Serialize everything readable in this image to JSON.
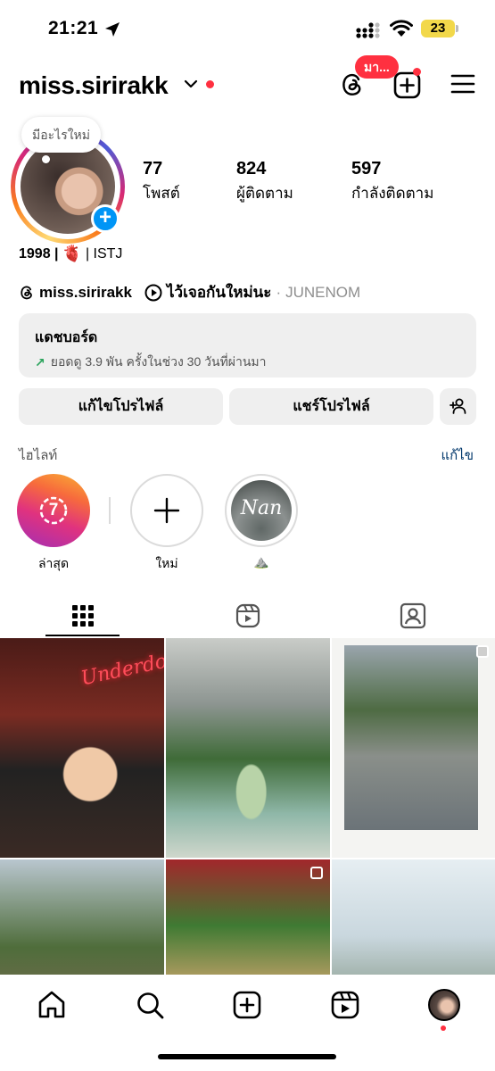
{
  "status_bar": {
    "time": "21:21",
    "battery": "23"
  },
  "header": {
    "username": "miss.sirirakk",
    "threads_badge": "มา..."
  },
  "profile": {
    "note": "มีอะไรใหม่",
    "stats": [
      {
        "value": "77",
        "label": "โพสต์"
      },
      {
        "value": "824",
        "label": "ผู้ติดตาม"
      },
      {
        "value": "597",
        "label": "กำลังติดตาม"
      }
    ],
    "bio": {
      "year": "1998 |",
      "heart": "🫀",
      "mbti": "| ISTJ"
    },
    "threads_handle": "miss.sirirakk",
    "music_title": "ไว้เจอกันใหม่นะ",
    "music_sep": "·",
    "music_artist": "JUNENOM"
  },
  "dashboard": {
    "title": "แดชบอร์ด",
    "arrow": "↗",
    "subtitle": "ยอดดู 3.9 พัน ครั้งในช่วง 30 วันที่ผ่านมา"
  },
  "buttons": {
    "edit_profile": "แก้ไขโปรไฟล์",
    "share_profile": "แชร์โปรไฟล์"
  },
  "highlights": {
    "title": "ไฮไลท์",
    "edit": "แก้ไข",
    "items": [
      {
        "label": "ล่าสุด",
        "badge": "7"
      },
      {
        "label": "ใหม่"
      },
      {
        "label": "⛰️",
        "cover_text": "Nan"
      }
    ]
  },
  "grid": {
    "posts": [
      {
        "overlay": "Underdog",
        "multi": false
      },
      {
        "overlay": "",
        "multi": false
      },
      {
        "overlay": "",
        "multi": true
      },
      {
        "overlay": "",
        "multi": false
      },
      {
        "overlay": "",
        "multi": true
      },
      {
        "overlay": "",
        "multi": false
      }
    ]
  },
  "colors": {
    "accent_blue": "#0095f6",
    "notification_red": "#ff3040",
    "link_blue": "#00376b",
    "growth_green": "#29a35b"
  }
}
